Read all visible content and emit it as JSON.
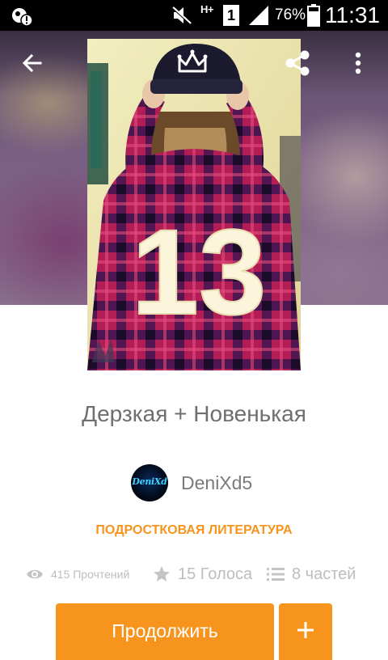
{
  "status_bar": {
    "network": "H+",
    "sim": "1",
    "battery": "76%",
    "time": "11:31",
    "icons": [
      "notification-icon",
      "mute-icon",
      "signal-icon",
      "battery-icon"
    ]
  },
  "toolbar": {
    "back_icon": "arrow-left-icon",
    "share_icon": "share-icon",
    "more_icon": "more-vertical-icon"
  },
  "cover": {
    "jersey_number": "13"
  },
  "story": {
    "title": "Дерзкая + Новенькая",
    "author": {
      "name": "DeniXd5",
      "avatar_text": "DeniXd"
    },
    "category": "ПОДРОСТКОВАЯ ЛИТЕРАТУРА",
    "stats": {
      "reads": "415 Прочтений",
      "votes": "15 Голоса",
      "parts": "8 частей"
    }
  },
  "actions": {
    "continue_label": "Продолжить",
    "add_label": "+"
  },
  "colors": {
    "accent": "#f7941d",
    "title_text": "#6f6f6f",
    "muted_text": "#bdbdbd"
  }
}
